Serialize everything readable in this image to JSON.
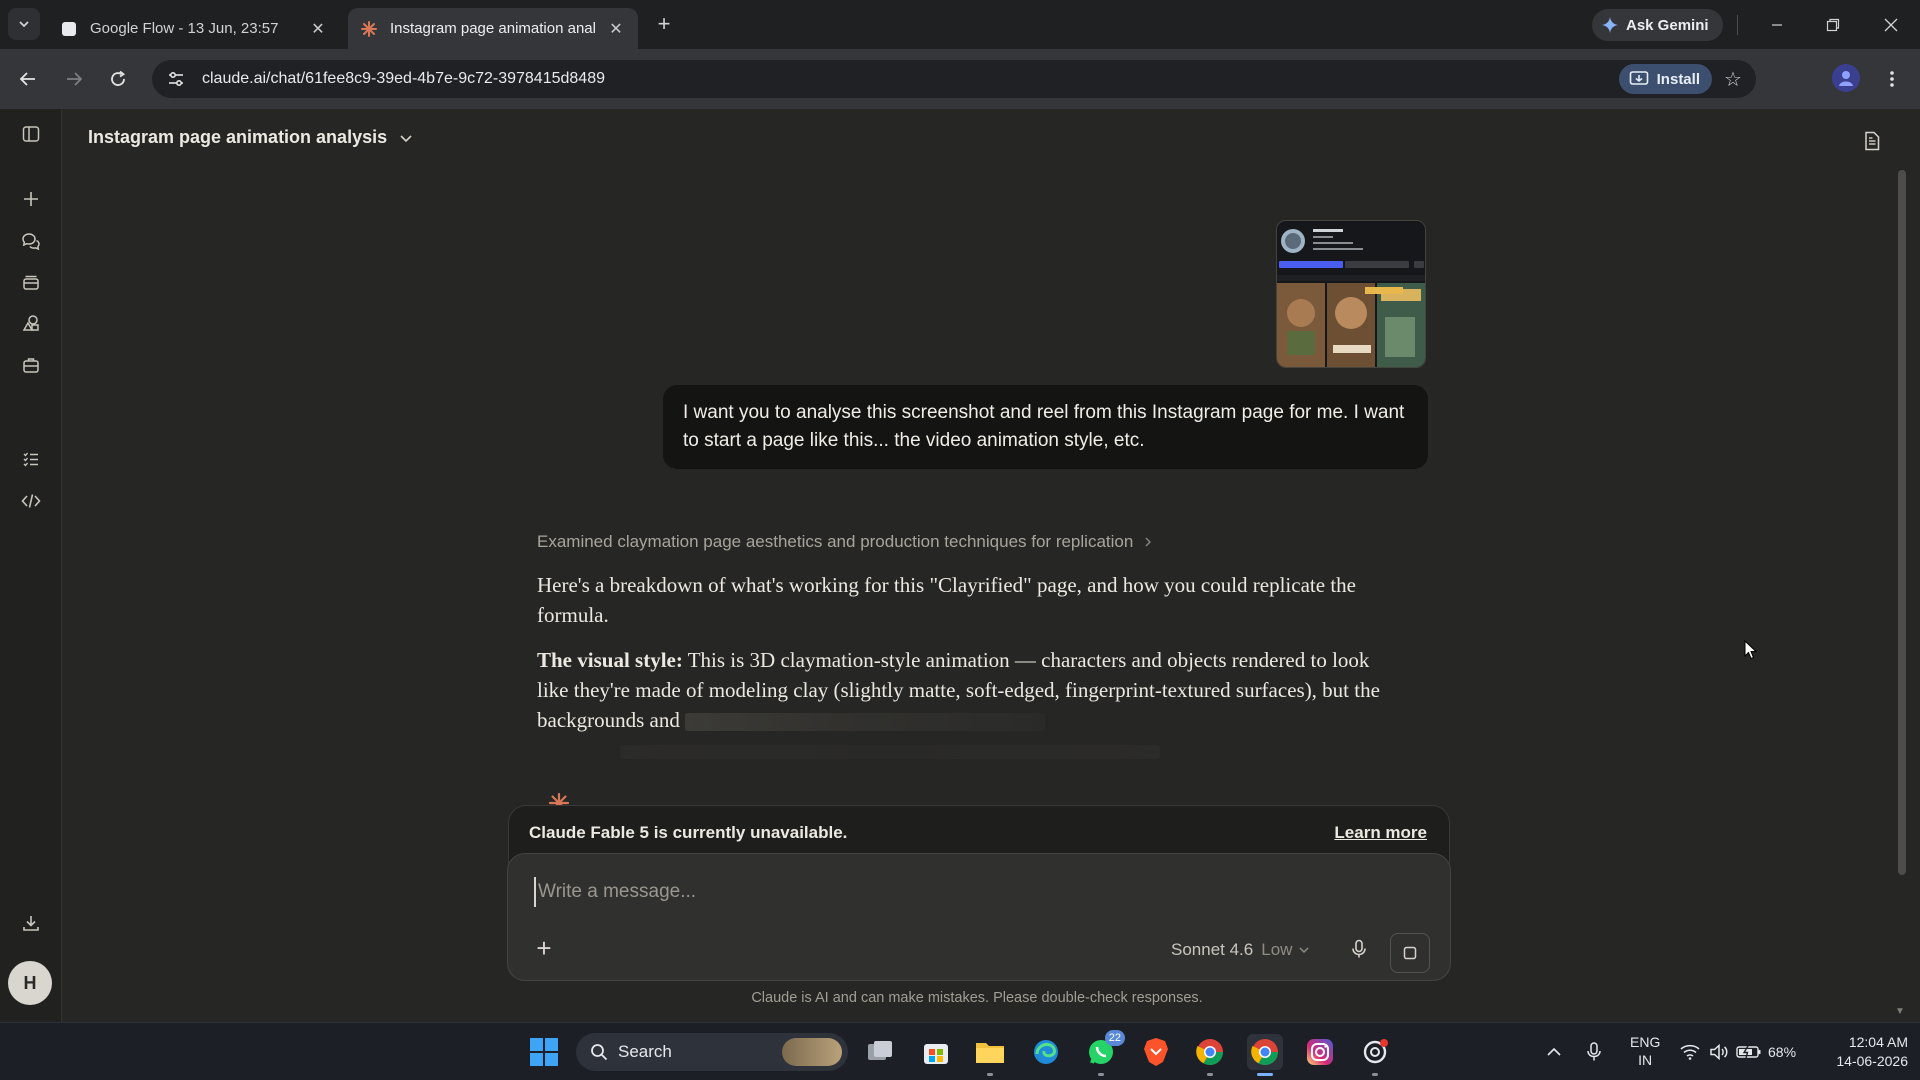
{
  "browser": {
    "tabs": [
      {
        "title": "Google Flow - 13 Jun, 23:57",
        "active": false
      },
      {
        "title": "Instagram page animation anal",
        "active": true
      }
    ],
    "ask_gemini": "Ask Gemini",
    "url": "claude.ai/chat/61fee8c9-39ed-4b7e-9c72-3978415d8489",
    "install": "Install"
  },
  "chat": {
    "title": "Instagram page animation analysis",
    "user_message": "I want you to analyse this screenshot and reel from this Instagram page for me. I  want to start a page like this... the video animation style, etc.",
    "thinking_summary": "Examined claymation page aesthetics and production techniques for replication",
    "response": {
      "p1": "Here's a breakdown of what's working for this \"Clayrified\" page, and how you could replicate the formula.",
      "p2_bold": "The visual style:",
      "p2_text": " This is 3D claymation-style animation — characters and objects rendered to look like they're made of modeling clay (slightly matte, soft-edged, fingerprint-textured surfaces), but the backgrounds and"
    },
    "banner": {
      "message": "Claude Fable 5 is currently unavailable.",
      "link": "Learn more"
    },
    "composer": {
      "placeholder": "Write a message...",
      "model": "Sonnet 4.6",
      "effort": "Low"
    },
    "disclaimer": "Claude is AI and can make mistakes. Please double-check responses.",
    "user_initial": "H"
  },
  "taskbar": {
    "search": "Search",
    "whatsapp_badge": "22",
    "lang_line1": "ENG",
    "lang_line2": "IN",
    "battery": "68%",
    "time": "12:04 AM",
    "date": "14-06-2026"
  },
  "colors": {
    "app_bg": "#262624",
    "accent_claude": "#d97757",
    "install_bg": "#3c4f6e"
  }
}
